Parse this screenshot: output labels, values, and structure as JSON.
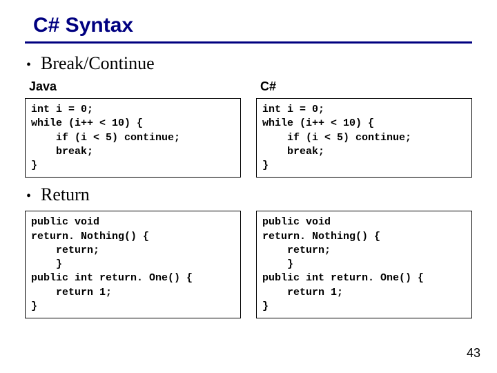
{
  "title": "C# Syntax",
  "page_number": "43",
  "sections": [
    {
      "heading": "Break/Continue",
      "columns": [
        {
          "label": "Java",
          "code": "int i = 0;\nwhile (i++ < 10) {\n    if (i < 5) continue;\n    break;\n}"
        },
        {
          "label": "C#",
          "code": "int i = 0;\nwhile (i++ < 10) {\n    if (i < 5) continue;\n    break;\n}"
        }
      ]
    },
    {
      "heading": "Return",
      "columns": [
        {
          "label": null,
          "code": "public void\nreturn. Nothing() {\n    return;\n    }\npublic int return. One() {\n    return 1;\n}"
        },
        {
          "label": null,
          "code": "public void\nreturn. Nothing() {\n    return;\n    }\npublic int return. One() {\n    return 1;\n}"
        }
      ]
    }
  ]
}
